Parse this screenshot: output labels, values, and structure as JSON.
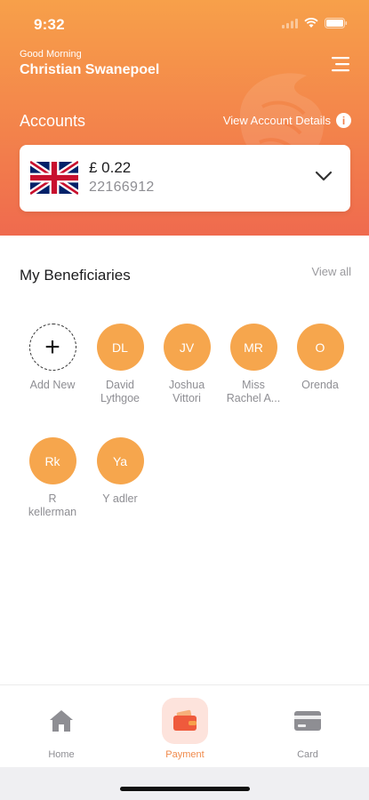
{
  "status": {
    "time": "9:32"
  },
  "header": {
    "greeting": "Good Morning",
    "username": "Christian Swanepoel"
  },
  "accounts": {
    "title": "Accounts",
    "view_details": "View Account Details",
    "balance": "£ 0.22",
    "number": "22166912"
  },
  "beneficiaries": {
    "title": "My Beneficiaries",
    "view_all": "View all",
    "add_label": "Add New",
    "items": [
      {
        "initials": "DL",
        "name_line1": "David",
        "name_line2": "Lythgoe"
      },
      {
        "initials": "JV",
        "name_line1": "Joshua",
        "name_line2": "Vittori"
      },
      {
        "initials": "MR",
        "name_line1": "Miss",
        "name_line2": "Rachel A..."
      },
      {
        "initials": "O",
        "name_line1": "Orenda",
        "name_line2": ""
      },
      {
        "initials": "Rk",
        "name_line1": "R",
        "name_line2": "kellerman"
      },
      {
        "initials": "Ya",
        "name_line1": "Y adler",
        "name_line2": ""
      }
    ]
  },
  "tabs": [
    {
      "label": "Home",
      "icon": "home-icon",
      "active": false
    },
    {
      "label": "Payment",
      "icon": "wallet-icon",
      "active": true
    },
    {
      "label": "Card",
      "icon": "card-icon",
      "active": false
    }
  ],
  "colors": {
    "header_gradient_top": "#f7a04a",
    "header_gradient_bottom": "#ef6a4e",
    "avatar_orange": "#f6a64d",
    "active_tab": "#f08a4b"
  }
}
